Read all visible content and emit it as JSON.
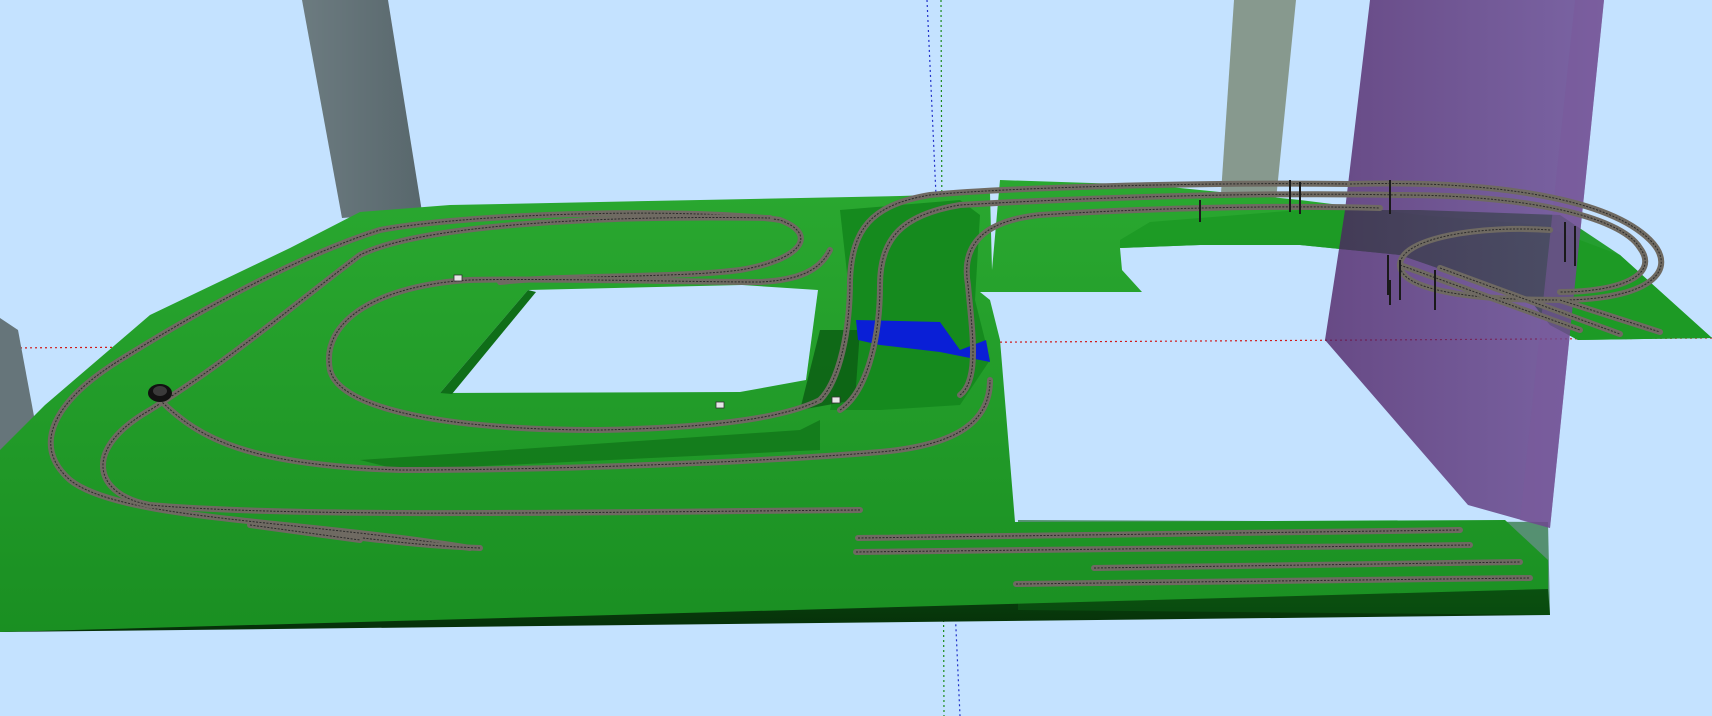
{
  "app": {
    "view": "3d-perspective",
    "background_color": "#c4e2ff"
  },
  "scene": {
    "board_color": "#1f9a27",
    "board_edge_color": "#0a4a10",
    "board_shadow_color": "#0e6b16",
    "water_color": "#0a1fd6",
    "track_ballast_color": "#6f6a62",
    "track_rail_color": "#2a2a2a",
    "pillar_color": "#5f6f74",
    "pillar_light_color": "#8a947a",
    "selection_volume_color": "#5a2a6e",
    "axis_x_color": "#d11818",
    "axis_y_color": "#1a8a1a",
    "axis_z_color": "#2030c8"
  },
  "icons": {
    "tunnel_portal": "tunnel-portal-icon",
    "signal": "signal-icon"
  }
}
